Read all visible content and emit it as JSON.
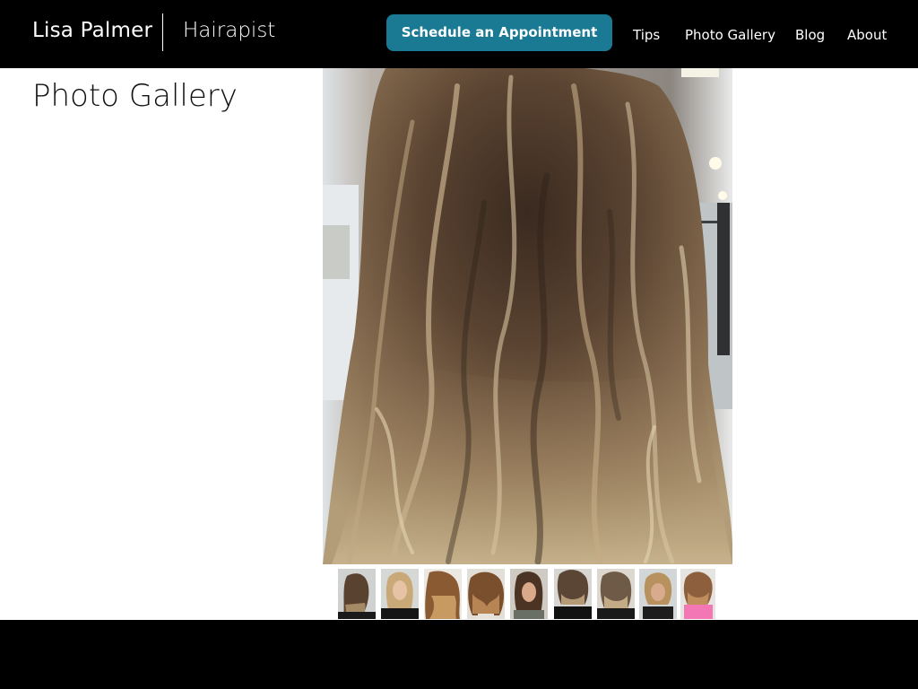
{
  "header": {
    "brand_name": "Lisa Palmer",
    "brand_tagline": "Hairapist",
    "cta_label": "Schedule an Appointment",
    "nav": [
      {
        "label": "Tips"
      },
      {
        "label": "Photo Gallery"
      },
      {
        "label": "Blog"
      },
      {
        "label": "About"
      }
    ]
  },
  "main": {
    "title": "Photo Gallery"
  },
  "colors": {
    "header_bg": "#000000",
    "cta_bg": "#1a7a94",
    "footer_bg": "#000000"
  }
}
